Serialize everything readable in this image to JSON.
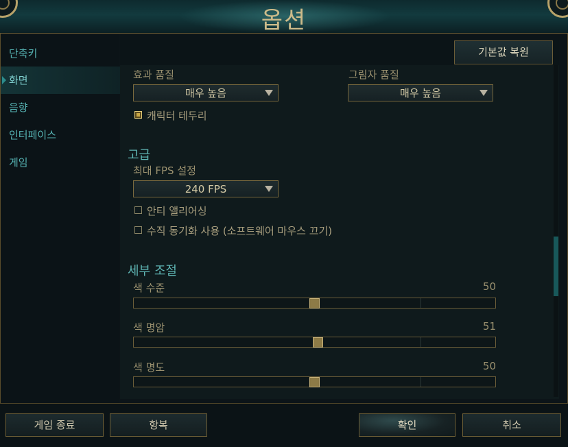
{
  "window": {
    "title": "옵션"
  },
  "sidebar": {
    "items": [
      {
        "label": "단축키",
        "active": false
      },
      {
        "label": "화면",
        "active": true
      },
      {
        "label": "음향",
        "active": false
      },
      {
        "label": "인터페이스",
        "active": false
      },
      {
        "label": "게임",
        "active": false
      }
    ]
  },
  "toolbar": {
    "reset_label": "기본값 복원"
  },
  "graphics": {
    "effects_quality_label": "효과 품질",
    "effects_quality_value": "매우 높음",
    "shadow_quality_label": "그림자 품질",
    "shadow_quality_value": "매우 높음",
    "character_outline_label": "캐릭터 테두리",
    "character_outline_checked": true
  },
  "advanced": {
    "section_title": "고급",
    "max_fps_label": "최대 FPS 설정",
    "max_fps_value": "240 FPS",
    "anti_aliasing_label": "안티 앨리어싱",
    "anti_aliasing_checked": false,
    "vsync_label": "수직 동기화 사용 (소프트웨어 마우스 끄기)",
    "vsync_checked": false
  },
  "fine_tuning": {
    "section_title": "세부 조절",
    "sliders": [
      {
        "label": "색 수준",
        "value": "50",
        "fraction": 0.5
      },
      {
        "label": "색 명암",
        "value": "51",
        "fraction": 0.51
      },
      {
        "label": "색 명도",
        "value": "50",
        "fraction": 0.5
      }
    ]
  },
  "scroll": {
    "position_fraction": 0.63,
    "thumb_fraction": 0.18
  },
  "footer": {
    "exit_game_label": "게임 종료",
    "surrender_label": "항복",
    "confirm_label": "확인",
    "cancel_label": "취소"
  },
  "colors": {
    "accent": "#5fb6b4",
    "gold": "#c9b37a",
    "background": "#0c1418"
  }
}
